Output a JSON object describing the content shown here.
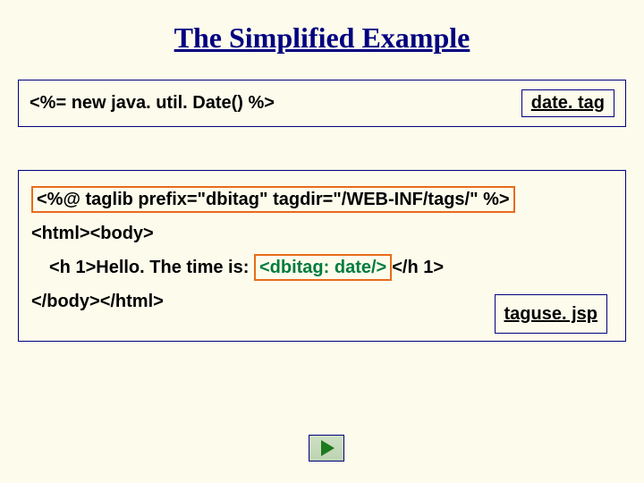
{
  "title": "The Simplified Example",
  "box1": {
    "code": "<%= new java. util. Date() %>",
    "filename": "date. tag"
  },
  "box2": {
    "taglib_line": "<%@ taglib prefix=\"dbitag\" tagdir=\"/WEB-INF/tags/\" %>",
    "line2": "<html><body>",
    "line3_pre": "<h 1>Hello. The time is: ",
    "line3_tag": "<dbitag: date/>",
    "line3_post": "</h 1>",
    "line4": "</body></html>",
    "filename": "taguse. jsp"
  },
  "nav": {
    "play_icon": "play-icon"
  }
}
